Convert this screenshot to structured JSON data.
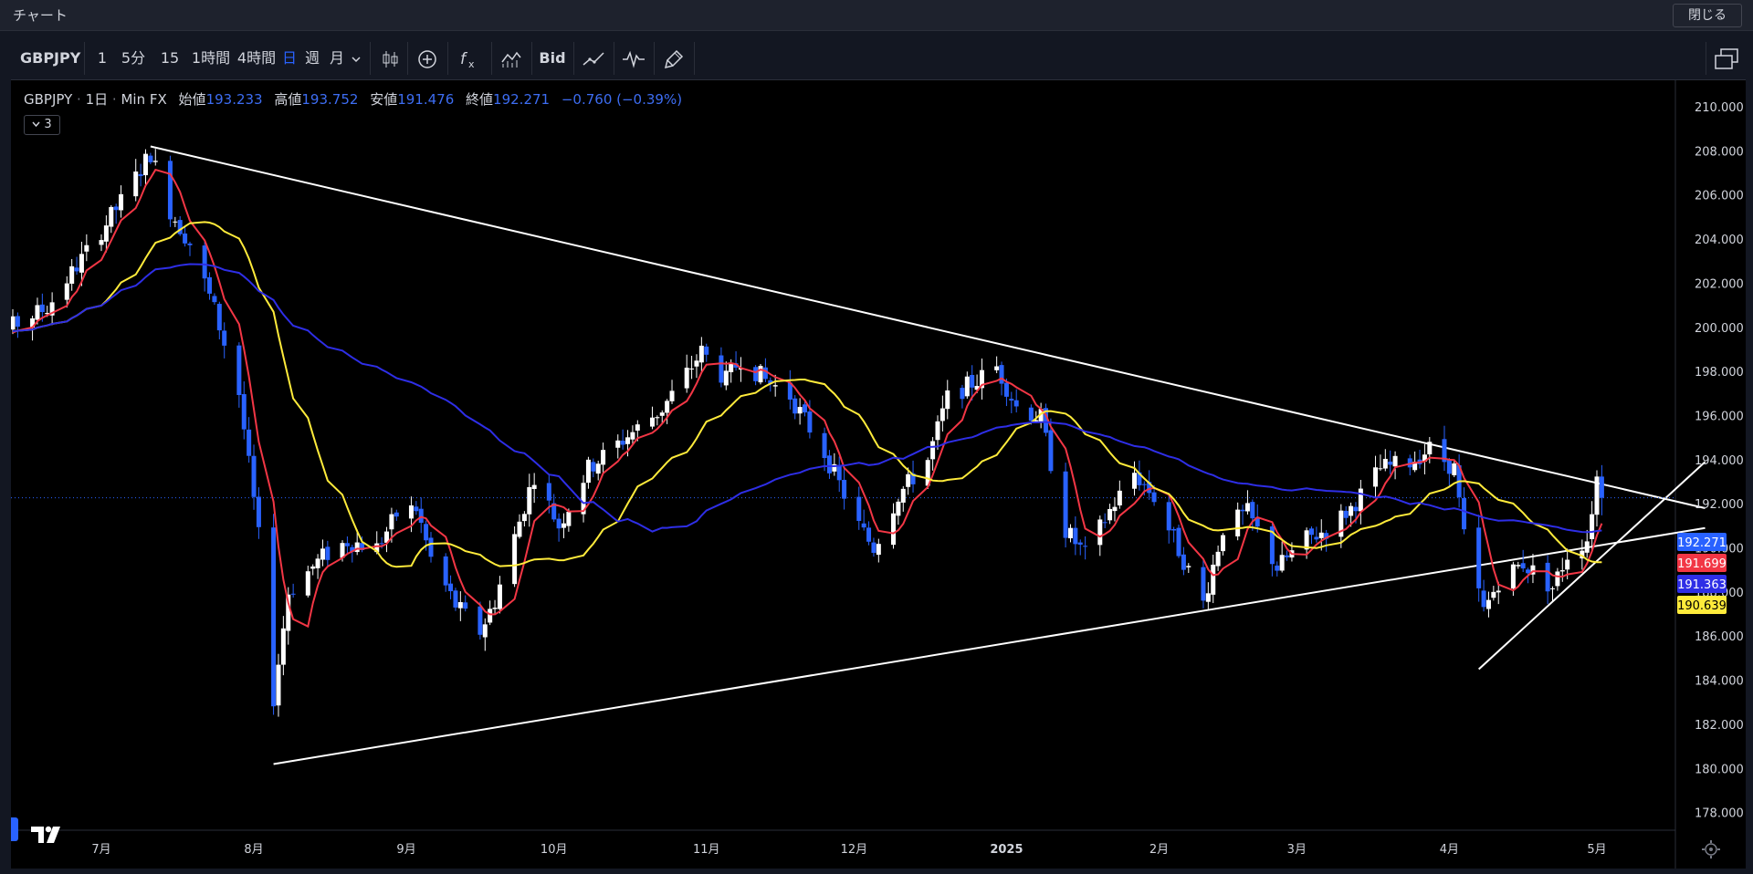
{
  "window": {
    "title": "チャート",
    "close_label": "閉じる"
  },
  "toolbar": {
    "symbol": "GBPJPY",
    "intervals": [
      "1分",
      "5分",
      "15分",
      "1時間",
      "4時間",
      "日",
      "週",
      "月"
    ],
    "active_interval": "日",
    "bid_label": "Bid"
  },
  "legend": {
    "symbol": "GBPJPY",
    "interval": "1日",
    "source": "Min FX",
    "open_label": "始値",
    "open": "193.233",
    "high_label": "高値",
    "high": "193.752",
    "low_label": "安値",
    "low": "191.476",
    "close_label": "終値",
    "close": "192.271",
    "change": "−0.760 (−0.39%)",
    "collapse_count": "3"
  },
  "colors": {
    "bull": "#ffffff",
    "bear": "#2962ff",
    "ma_short": "#f23645",
    "ma_mid": "#ffeb3b",
    "ma_long": "#2e2ee6",
    "trendline": "#ffffff"
  },
  "chart_data": {
    "type": "candlestick",
    "symbol": "GBPJPY",
    "interval": "1D",
    "y_range": [
      177.2,
      211.2
    ],
    "y_ticks": [
      "210.000",
      "208.000",
      "206.000",
      "204.000",
      "202.000",
      "200.000",
      "198.000",
      "196.000",
      "194.000",
      "192.000",
      "190.000",
      "188.000",
      "186.000",
      "184.000",
      "182.000",
      "180.000",
      "178.000"
    ],
    "x_labels": [
      {
        "label": "7月",
        "date": "2024-07-01"
      },
      {
        "label": "8月",
        "date": "2024-08-01"
      },
      {
        "label": "9月",
        "date": "2024-09-01"
      },
      {
        "label": "10月",
        "date": "2024-10-01"
      },
      {
        "label": "11月",
        "date": "2024-11-01"
      },
      {
        "label": "12月",
        "date": "2024-12-01"
      },
      {
        "label": "2025",
        "date": "2025-01-01",
        "bold": true
      },
      {
        "label": "2月",
        "date": "2025-02-01"
      },
      {
        "label": "3月",
        "date": "2025-03-01"
      },
      {
        "label": "4月",
        "date": "2025-04-01"
      },
      {
        "label": "5月",
        "date": "2025-05-01"
      }
    ],
    "anchors": [
      [
        "2024-06-03",
        200.0
      ],
      [
        "2024-06-10",
        199.7
      ],
      [
        "2024-06-20",
        200.9
      ],
      [
        "2024-06-28",
        203.4
      ],
      [
        "2024-07-05",
        205.7
      ],
      [
        "2024-07-11",
        207.9
      ],
      [
        "2024-07-15",
        205.3
      ],
      [
        "2024-07-19",
        203.8
      ],
      [
        "2024-07-24",
        200.8
      ],
      [
        "2024-07-29",
        197.0
      ],
      [
        "2024-08-02",
        190.5
      ],
      [
        "2024-08-05",
        183.2
      ],
      [
        "2024-08-08",
        188.0
      ],
      [
        "2024-08-15",
        189.6
      ],
      [
        "2024-08-20",
        190.3
      ],
      [
        "2024-08-26",
        190.0
      ],
      [
        "2024-08-30",
        191.5
      ],
      [
        "2024-09-03",
        191.8
      ],
      [
        "2024-09-06",
        189.5
      ],
      [
        "2024-09-11",
        187.4
      ],
      [
        "2024-09-16",
        186.2
      ],
      [
        "2024-09-19",
        187.6
      ],
      [
        "2024-09-24",
        191.2
      ],
      [
        "2024-09-27",
        193.3
      ],
      [
        "2024-10-02",
        191.0
      ],
      [
        "2024-10-08",
        193.6
      ],
      [
        "2024-10-15",
        194.9
      ],
      [
        "2024-10-23",
        196.3
      ],
      [
        "2024-10-28",
        197.9
      ],
      [
        "2024-10-31",
        198.9
      ],
      [
        "2024-11-05",
        197.6
      ],
      [
        "2024-11-08",
        198.6
      ],
      [
        "2024-11-13",
        197.6
      ],
      [
        "2024-11-18",
        196.9
      ],
      [
        "2024-11-25",
        194.3
      ],
      [
        "2024-12-02",
        191.0
      ],
      [
        "2024-12-05",
        190.0
      ],
      [
        "2024-12-10",
        192.4
      ],
      [
        "2024-12-16",
        194.0
      ],
      [
        "2024-12-20",
        196.8
      ],
      [
        "2024-12-26",
        197.6
      ],
      [
        "2024-12-30",
        198.2
      ],
      [
        "2025-01-03",
        196.4
      ],
      [
        "2025-01-08",
        195.9
      ],
      [
        "2025-01-13",
        190.8
      ],
      [
        "2025-01-17",
        189.7
      ],
      [
        "2025-01-22",
        191.7
      ],
      [
        "2025-01-27",
        193.4
      ],
      [
        "2025-01-31",
        192.3
      ],
      [
        "2025-02-04",
        190.4
      ],
      [
        "2025-02-10",
        187.5
      ],
      [
        "2025-02-14",
        190.9
      ],
      [
        "2025-02-19",
        191.6
      ],
      [
        "2025-02-25",
        189.1
      ],
      [
        "2025-03-03",
        190.4
      ],
      [
        "2025-03-07",
        190.8
      ],
      [
        "2025-03-12",
        191.8
      ],
      [
        "2025-03-18",
        193.6
      ],
      [
        "2025-03-24",
        193.9
      ],
      [
        "2025-03-28",
        194.5
      ],
      [
        "2025-04-02",
        193.6
      ],
      [
        "2025-04-04",
        190.5
      ],
      [
        "2025-04-08",
        187.1
      ],
      [
        "2025-04-11",
        188.5
      ],
      [
        "2025-04-16",
        189.3
      ],
      [
        "2025-04-22",
        188.2
      ],
      [
        "2025-04-25",
        189.7
      ],
      [
        "2025-04-29",
        190.4
      ],
      [
        "2025-05-01",
        193.2
      ],
      [
        "2025-05-02",
        192.271
      ]
    ],
    "last_bar": {
      "open": 193.233,
      "high": 193.752,
      "low": 191.476,
      "close": 192.271
    },
    "moving_averages": [
      {
        "period_days": 5,
        "color": "#f23645",
        "last_value": 191.699
      },
      {
        "period_days": 20,
        "color": "#ffeb3b",
        "last_value": 190.639
      },
      {
        "period_days": 60,
        "color": "#2e2ee6",
        "last_value": 191.363
      }
    ],
    "price_labels": [
      {
        "value": "192.271",
        "price": 192.271,
        "bg": "#2962ff",
        "fg": "#ffffff"
      },
      {
        "value": "191.699",
        "price": 191.699,
        "bg": "#f23645",
        "fg": "#ffffff"
      },
      {
        "value": "191.363",
        "price": 191.363,
        "bg": "#2e2ee6",
        "fg": "#ffffff"
      },
      {
        "value": "190.639",
        "price": 190.639,
        "bg": "#ffeb3b",
        "fg": "#000000"
      }
    ],
    "trendlines": [
      {
        "from": [
          "2024-07-11",
          208.2
        ],
        "to": [
          "2025-05-23",
          191.8
        ]
      },
      {
        "from": [
          "2024-08-05",
          180.2
        ],
        "to": [
          "2025-05-23",
          190.9
        ]
      },
      {
        "from": [
          "2025-04-07",
          184.5
        ],
        "to": [
          "2025-05-23",
          193.9
        ]
      }
    ],
    "current_price_line": 192.271,
    "grid": false
  }
}
